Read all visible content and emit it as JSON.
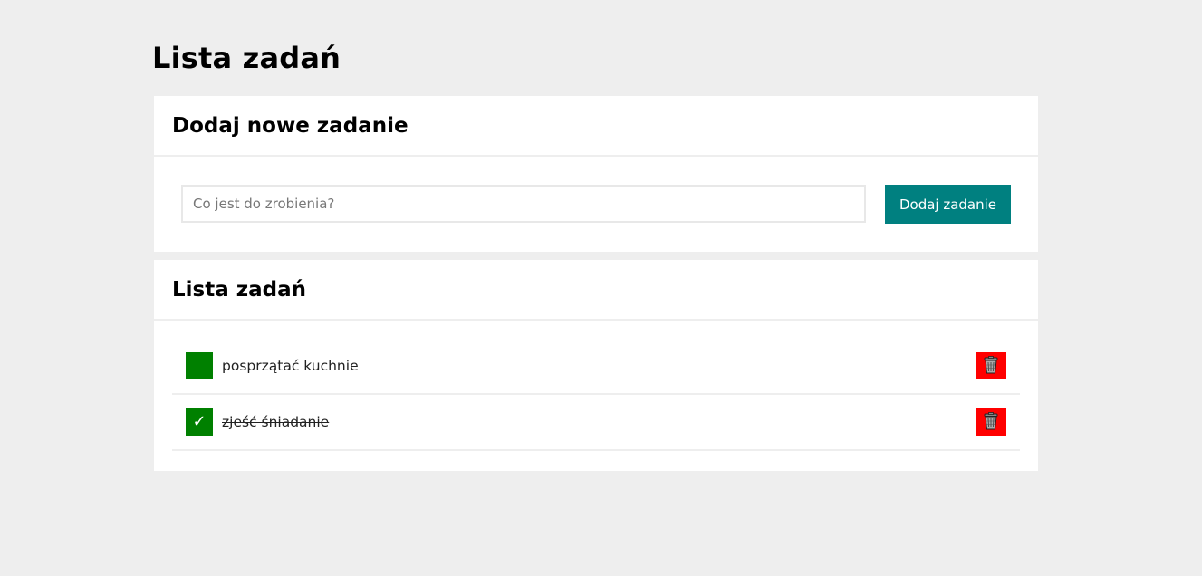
{
  "page": {
    "title": "Lista zadań"
  },
  "add_section": {
    "heading": "Dodaj nowe zadanie",
    "input_placeholder": "Co jest do zrobienia?",
    "input_value": "",
    "button_label": "Dodaj zadanie"
  },
  "list_section": {
    "heading": "Lista zadań",
    "tasks": [
      {
        "text": "posprzątać kuchnie",
        "done": false,
        "check_mark": ""
      },
      {
        "text": "zjeść śniadanie",
        "done": true,
        "check_mark": "✓"
      }
    ]
  },
  "colors": {
    "accent": "#008080",
    "check": "#008000",
    "delete": "#ff0000",
    "background": "#eeeeee"
  },
  "icons": {
    "check": "check-icon",
    "delete": "trash-icon"
  }
}
